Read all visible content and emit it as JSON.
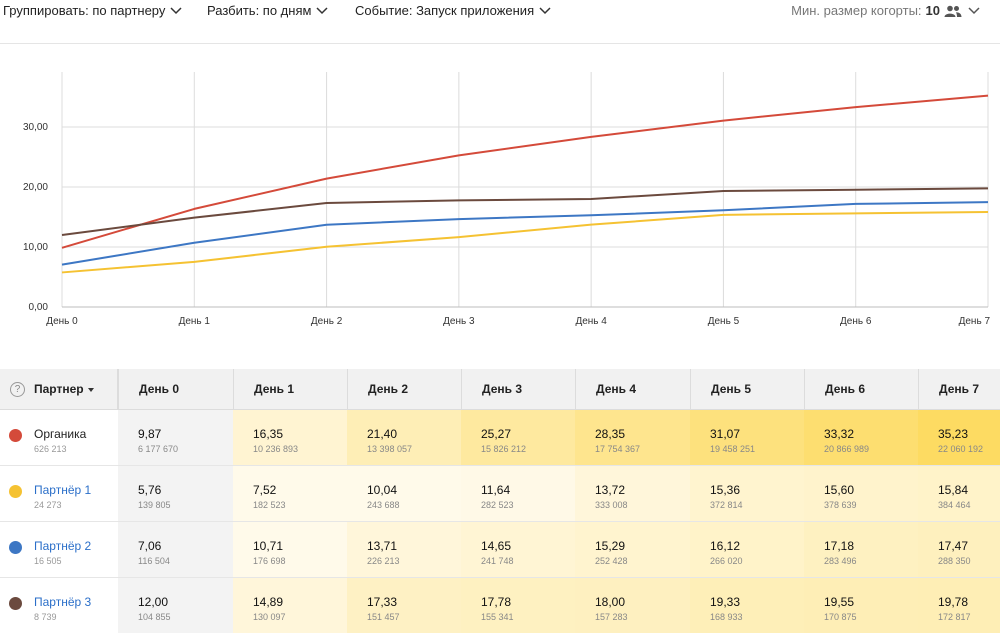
{
  "toolbar": {
    "group_by": "Группировать: по партнеру",
    "split_by": "Разбить: по дням",
    "event": "Событие: Запуск приложения",
    "min_cohort_label": "Мин. размер когорты:",
    "min_cohort_value": "10"
  },
  "colors": {
    "Органика": "#d44a3a",
    "Партнёр 1": "#f5c232",
    "Партнёр 2": "#3d77c4",
    "Партнёр 3": "#6b4a3e",
    "heat_low": "#fffaea",
    "heat_high": "#fddb62"
  },
  "chart_data": {
    "type": "line",
    "x": [
      "День 0",
      "День 1",
      "День 2",
      "День 3",
      "День 4",
      "День 5",
      "День 6",
      "День 7"
    ],
    "y_ticks": [
      "0,00",
      "10,00",
      "20,00",
      "30,00"
    ],
    "ylim": [
      0,
      39
    ],
    "grid": true,
    "series": [
      {
        "name": "Органика",
        "values": [
          9.87,
          16.35,
          21.4,
          25.27,
          28.35,
          31.07,
          33.32,
          35.23
        ]
      },
      {
        "name": "Партнёр 1",
        "values": [
          5.76,
          7.52,
          10.04,
          11.64,
          13.72,
          15.36,
          15.6,
          15.84
        ]
      },
      {
        "name": "Партнёр 2",
        "values": [
          7.06,
          10.71,
          13.71,
          14.65,
          15.29,
          16.12,
          17.18,
          17.47
        ]
      },
      {
        "name": "Партнёр 3",
        "values": [
          12.0,
          14.89,
          17.33,
          17.78,
          18.0,
          19.33,
          19.55,
          19.78
        ]
      }
    ]
  },
  "table": {
    "help": "?",
    "partner_header": "Партнер",
    "day_headers": [
      "День 0",
      "День 1",
      "День 2",
      "День 3",
      "День 4",
      "День 5",
      "День 6",
      "День 7"
    ],
    "rows": [
      {
        "name": "Органика",
        "link": false,
        "count": "626 213",
        "cells": [
          {
            "value": "9,87",
            "sub": "6 177 670",
            "heat": 0
          },
          {
            "value": "16,35",
            "sub": "10 236 893",
            "heat": 0.18
          },
          {
            "value": "21,40",
            "sub": "13 398 057",
            "heat": 0.38
          },
          {
            "value": "25,27",
            "sub": "15 826 212",
            "heat": 0.55
          },
          {
            "value": "28,35",
            "sub": "17 754 367",
            "heat": 0.68
          },
          {
            "value": "31,07",
            "sub": "19 458 251",
            "heat": 0.8
          },
          {
            "value": "33,32",
            "sub": "20 866 989",
            "heat": 0.9
          },
          {
            "value": "35,23",
            "sub": "22 060 192",
            "heat": 1
          }
        ]
      },
      {
        "name": "Партнёр 1",
        "link": true,
        "count": "24 273",
        "cells": [
          {
            "value": "5,76",
            "sub": "139 805",
            "heat": 0
          },
          {
            "value": "7,52",
            "sub": "182 523",
            "heat": 0
          },
          {
            "value": "10,04",
            "sub": "243 688",
            "heat": 0
          },
          {
            "value": "11,64",
            "sub": "282 523",
            "heat": 0.02
          },
          {
            "value": "13,72",
            "sub": "333 008",
            "heat": 0.12
          },
          {
            "value": "15,36",
            "sub": "372 814",
            "heat": 0.2
          },
          {
            "value": "15,60",
            "sub": "378 639",
            "heat": 0.22
          },
          {
            "value": "15,84",
            "sub": "384 464",
            "heat": 0.24
          }
        ]
      },
      {
        "name": "Партнёр 2",
        "link": true,
        "count": "16 505",
        "cells": [
          {
            "value": "7,06",
            "sub": "116 504",
            "heat": 0
          },
          {
            "value": "10,71",
            "sub": "176 698",
            "heat": 0
          },
          {
            "value": "13,71",
            "sub": "226 213",
            "heat": 0.12
          },
          {
            "value": "14,65",
            "sub": "241 748",
            "heat": 0.16
          },
          {
            "value": "15,29",
            "sub": "252 428",
            "heat": 0.2
          },
          {
            "value": "16,12",
            "sub": "266 020",
            "heat": 0.24
          },
          {
            "value": "17,18",
            "sub": "283 496",
            "heat": 0.3
          },
          {
            "value": "17,47",
            "sub": "288 350",
            "heat": 0.32
          }
        ]
      },
      {
        "name": "Партнёр 3",
        "link": true,
        "count": "8 739",
        "cells": [
          {
            "value": "12,00",
            "sub": "104 855",
            "heat": 0
          },
          {
            "value": "14,89",
            "sub": "130 097",
            "heat": 0.12
          },
          {
            "value": "17,33",
            "sub": "151 457",
            "heat": 0.28
          },
          {
            "value": "17,78",
            "sub": "155 341",
            "heat": 0.3
          },
          {
            "value": "18,00",
            "sub": "157 283",
            "heat": 0.31
          },
          {
            "value": "19,33",
            "sub": "168 933",
            "heat": 0.37
          },
          {
            "value": "19,55",
            "sub": "170 875",
            "heat": 0.38
          },
          {
            "value": "19,78",
            "sub": "172 817",
            "heat": 0.39
          }
        ]
      }
    ]
  }
}
